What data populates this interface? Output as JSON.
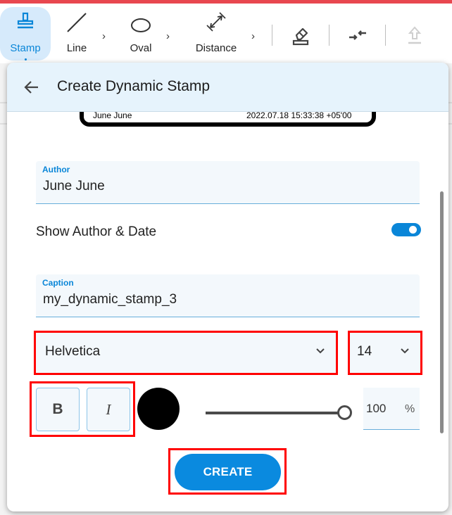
{
  "toolbar": {
    "tools": [
      {
        "label": "Stamp",
        "icon": "stamp-icon",
        "active": true
      },
      {
        "label": "Line",
        "icon": "line-icon",
        "active": false
      },
      {
        "label": "Oval",
        "icon": "oval-icon",
        "active": false
      },
      {
        "label": "Distance",
        "icon": "distance-icon",
        "active": false
      }
    ],
    "actions": [
      {
        "icon": "eraser-icon",
        "enabled": true
      },
      {
        "icon": "collapse-arrows-icon",
        "enabled": true
      },
      {
        "icon": "upload-icon",
        "enabled": false
      }
    ],
    "accent_color": "#e8474f"
  },
  "panel": {
    "title": "Create Dynamic Stamp",
    "back_icon": "arrow-left-icon",
    "stamp_preview": {
      "author": "June June",
      "date": "2022.07.18 15:33:38 +05'00"
    },
    "author_field": {
      "label": "Author",
      "value": "June June"
    },
    "show_author_date": {
      "label": "Show Author & Date",
      "on": true
    },
    "caption_field": {
      "label": "Caption",
      "value": "my_dynamic_stamp_3"
    },
    "font_select": {
      "value": "Helvetica"
    },
    "size_select": {
      "value": "14"
    },
    "bold_label": "B",
    "italic_label": "I",
    "text_color": "#000000",
    "opacity": {
      "value": "100",
      "unit": "%",
      "fraction": 1.0
    },
    "create_label": "CREATE",
    "primary_color": "#0a8adf"
  }
}
